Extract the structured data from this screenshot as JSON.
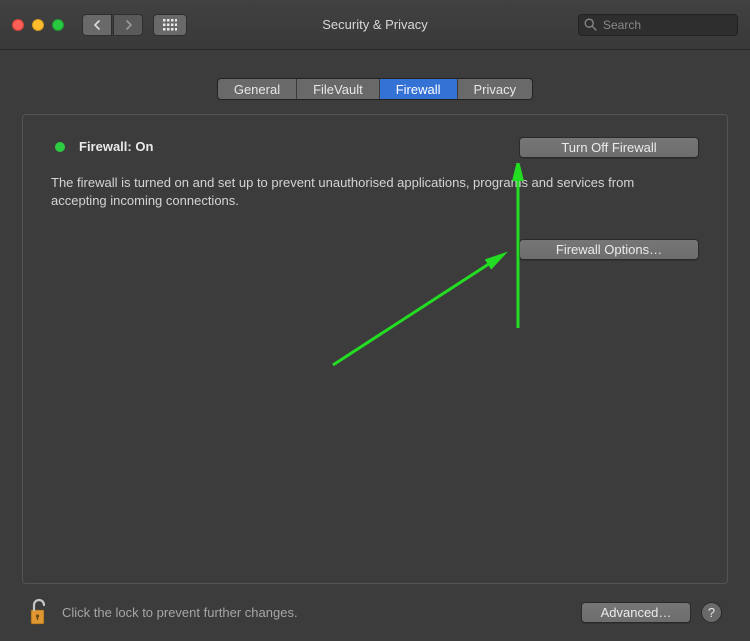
{
  "window": {
    "title": "Security & Privacy"
  },
  "search": {
    "placeholder": "Search",
    "value": ""
  },
  "tabs": {
    "general": "General",
    "filevault": "FileVault",
    "firewall": "Firewall",
    "privacy": "Privacy"
  },
  "status": {
    "label": "Firewall: On"
  },
  "buttons": {
    "turn_off": "Turn Off Firewall",
    "options": "Firewall Options…",
    "advanced": "Advanced…",
    "help": "?"
  },
  "description": "The firewall is turned on and set up to prevent unauthorised applications, programs and services from accepting incoming connections.",
  "footer": {
    "lock_text": "Click the lock to prevent further changes."
  },
  "colors": {
    "accent": "#3472d6",
    "status_on": "#2ecc40",
    "annotation_arrow": "#22dd22"
  }
}
